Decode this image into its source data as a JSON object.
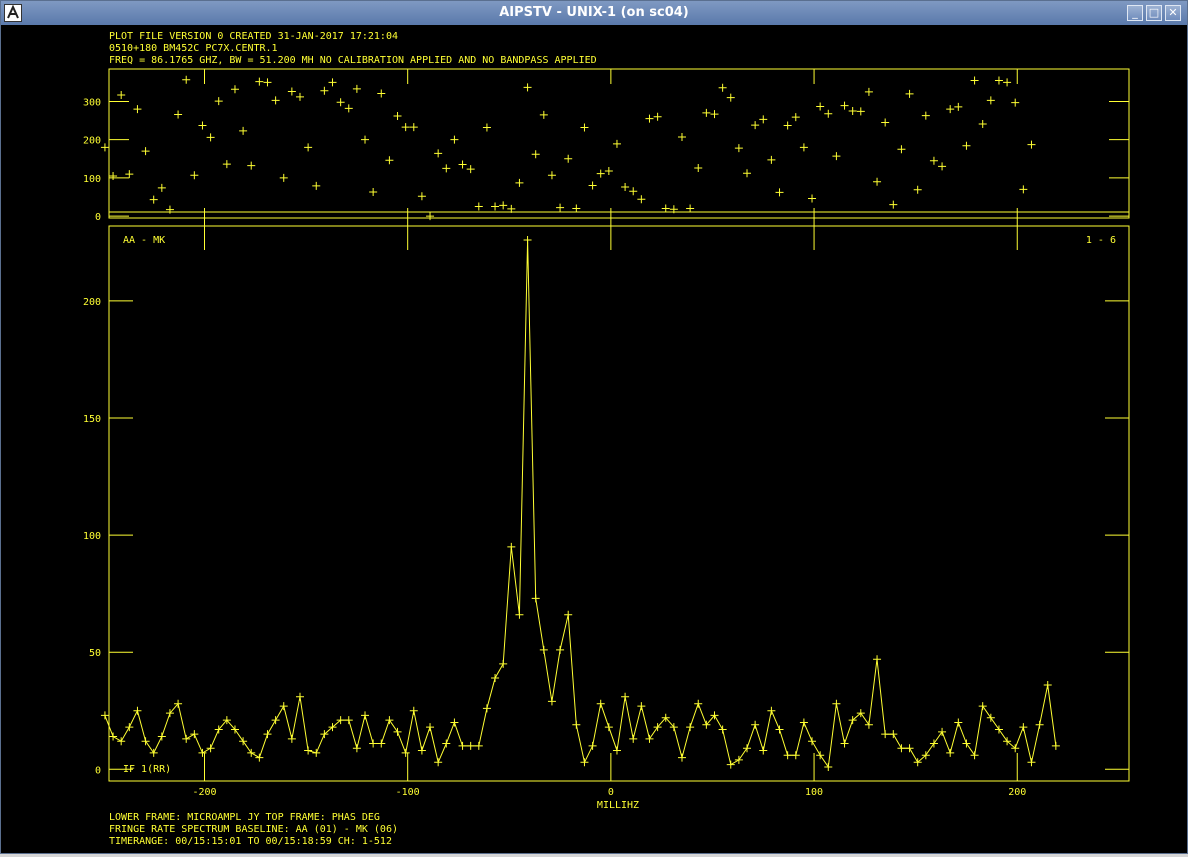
{
  "window": {
    "title": "AIPSTV - UNIX-1 (on sc04)",
    "buttons": {
      "minimize": "_",
      "maximize": "□",
      "close": "✕"
    },
    "icon": "aips-app-icon"
  },
  "header_lines": [
    "PLOT FILE VERSION 0  CREATED 31-JAN-2017 17:21:04",
    "0510+180   BM452C PC7X.CENTR.1",
    "FREQ = 86.1765 GHZ, BW = 51.200 MH   NO CALIBRATION APPLIED AND NO BANDPASS APPLIED"
  ],
  "footer_lines": [
    "LOWER FRAME: MICROAMPL JY   TOP FRAME: PHAS DEG",
    "FRINGE RATE SPECTRUM    BASELINE: AA (01) - MK (06)",
    "TIMERANGE: 00/15:15:01 TO 00/15:18:59 CH: 1-512"
  ],
  "plot_labels": {
    "baseline": "AA - MK",
    "antennas": "1 - 6",
    "if_label": "IF 1(RR)",
    "xlabel": "MILLIHZ"
  },
  "colors": {
    "plot": "#ffff33",
    "background": "#000000"
  },
  "chart_data": [
    {
      "type": "scatter",
      "panel": "top",
      "xlim": [
        -247,
        255
      ],
      "ylim": [
        -5,
        385
      ],
      "ytick_values": [
        0,
        100,
        200,
        300
      ],
      "yticks": [
        "0",
        "100",
        "200",
        "300"
      ],
      "x": [
        -249,
        -245,
        -241,
        -237,
        -233,
        -229,
        -225,
        -221,
        -217,
        -213,
        -209,
        -205,
        -201,
        -197,
        -193,
        -189,
        -185,
        -181,
        -177,
        -173,
        -169,
        -165,
        -161,
        -157,
        -153,
        -149,
        -145,
        -141,
        -137,
        -133,
        -129,
        -125,
        -121,
        -117,
        -113,
        -109,
        -105,
        -101,
        -97,
        -93,
        -89,
        -85,
        -81,
        -77,
        -73,
        -69,
        -65,
        -61,
        -57,
        -53,
        -49,
        -45,
        -41,
        -37,
        -33,
        -29,
        -25,
        -21,
        -17,
        -13,
        -9,
        -5,
        -1,
        3,
        7,
        11,
        15,
        19,
        23,
        27,
        31,
        35,
        39,
        43,
        47,
        51,
        55,
        59,
        63,
        67,
        71,
        75,
        79,
        83,
        87,
        91,
        95,
        99,
        103,
        107,
        111,
        115,
        119,
        123,
        127,
        131,
        135,
        139,
        143,
        147,
        151,
        155,
        159,
        163,
        167,
        171,
        175,
        179,
        183,
        187,
        191,
        195,
        199,
        203,
        207,
        211,
        215,
        219,
        223,
        227,
        231,
        235,
        239,
        243,
        247,
        251,
        255
      ],
      "y": [
        180,
        105,
        317,
        110,
        280,
        170,
        43,
        74,
        17,
        266,
        357,
        107,
        237,
        206,
        301,
        136,
        332,
        223,
        132,
        352,
        350,
        303,
        100,
        326,
        312,
        180,
        79,
        328,
        350,
        298,
        282,
        333,
        200,
        63,
        321,
        146,
        262,
        233,
        233,
        52,
        0,
        164,
        125,
        200,
        135,
        123,
        25,
        232,
        25,
        28,
        19,
        87,
        337,
        162,
        265,
        107,
        22,
        150,
        20,
        232,
        80,
        111,
        118,
        189,
        76,
        65,
        44,
        255,
        260,
        20,
        18,
        207,
        20,
        126,
        270,
        267,
        336,
        310,
        178,
        112,
        238,
        253,
        147,
        62,
        237,
        259,
        180,
        46,
        287,
        268,
        157,
        289,
        275,
        274,
        325,
        90,
        245,
        30,
        175,
        320,
        69,
        263,
        145,
        130,
        280,
        286,
        184,
        355,
        241,
        303,
        355,
        350,
        297,
        70,
        187
      ],
      "x_axis_ticks": [
        -200,
        -100,
        0,
        100,
        200
      ]
    },
    {
      "type": "line",
      "panel": "bottom",
      "xlim": [
        -247,
        255
      ],
      "ylim": [
        -5,
        232
      ],
      "ytick_values": [
        0,
        50,
        100,
        150,
        200
      ],
      "yticks": [
        "0",
        "50",
        "100",
        "150",
        "200"
      ],
      "xtick_values": [
        -200,
        -100,
        0,
        100,
        200
      ],
      "xticks": [
        "-200",
        "-100",
        "0",
        "100",
        "200"
      ],
      "x": [
        -249,
        -245,
        -241,
        -237,
        -233,
        -229,
        -225,
        -221,
        -217,
        -213,
        -209,
        -205,
        -201,
        -197,
        -193,
        -189,
        -185,
        -181,
        -177,
        -173,
        -169,
        -165,
        -161,
        -157,
        -153,
        -149,
        -145,
        -141,
        -137,
        -133,
        -129,
        -125,
        -121,
        -117,
        -113,
        -109,
        -105,
        -101,
        -97,
        -93,
        -89,
        -85,
        -81,
        -77,
        -73,
        -69,
        -65,
        -61,
        -57,
        -53,
        -49,
        -45,
        -41,
        -37,
        -33,
        -29,
        -25,
        -21,
        -17,
        -13,
        -9,
        -5,
        -1,
        3,
        7,
        11,
        15,
        19,
        23,
        27,
        31,
        35,
        39,
        43,
        47,
        51,
        55,
        59,
        63,
        67,
        71,
        75,
        79,
        83,
        87,
        91,
        95,
        99,
        103,
        107,
        111,
        115,
        119,
        123,
        127,
        131,
        135,
        139,
        143,
        147,
        151,
        155,
        159,
        163,
        167,
        171,
        175,
        179,
        183,
        187,
        191,
        195,
        199,
        203,
        207,
        211,
        215,
        219,
        223,
        227,
        231,
        235,
        239,
        243,
        247,
        251,
        255
      ],
      "y": [
        23,
        14,
        12,
        18,
        25,
        12,
        7,
        14,
        24,
        28,
        13,
        15,
        7,
        9,
        17,
        21,
        17,
        12,
        7,
        5,
        15,
        21,
        27,
        13,
        31,
        8,
        7,
        15,
        18,
        21,
        21,
        9,
        23,
        11,
        11,
        21,
        16,
        7,
        25,
        8,
        18,
        3,
        11,
        20,
        10,
        10,
        10,
        26,
        39,
        45,
        95,
        66,
        226,
        73,
        51,
        29,
        51,
        66,
        19,
        3,
        10,
        28,
        18,
        8,
        31,
        13,
        27,
        13,
        18,
        22,
        18,
        5,
        18,
        28,
        19,
        23,
        17,
        2,
        4,
        9,
        19,
        8,
        25,
        17,
        6,
        6,
        20,
        12,
        6,
        1,
        28,
        11,
        21,
        24,
        19,
        47,
        15,
        15,
        9,
        9,
        3,
        6,
        11,
        16,
        7,
        20,
        11,
        6,
        27,
        22,
        17,
        12,
        9,
        18,
        3,
        19,
        36,
        10
      ]
    }
  ]
}
